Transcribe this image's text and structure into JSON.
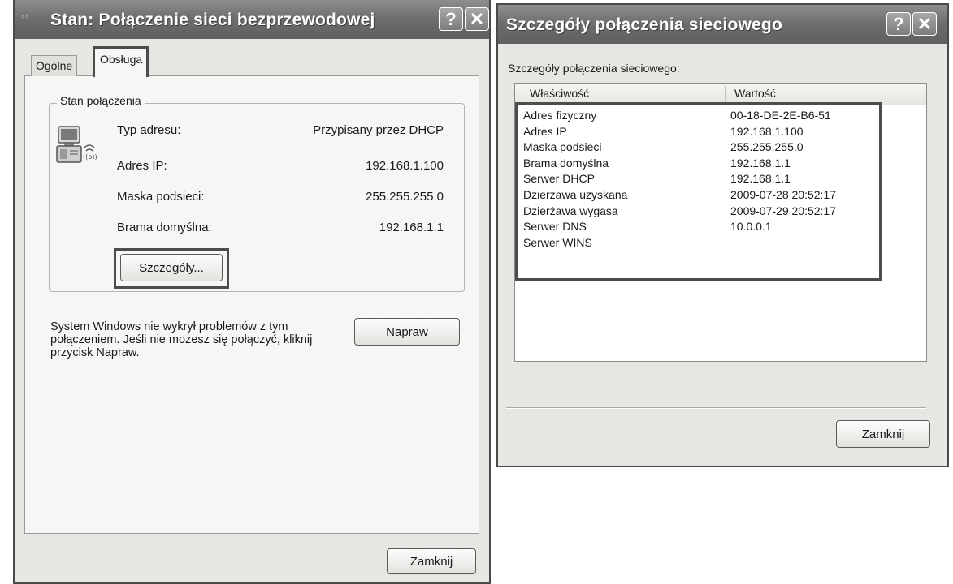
{
  "status_window": {
    "title": "Stan: Połączenie sieci bezprzewodowej",
    "help_glyph": "?",
    "close_glyph": "✕",
    "tabs": [
      {
        "label": "Ogólne",
        "active": false
      },
      {
        "label": "Obsługa",
        "active": true
      }
    ],
    "group_label": "Stan połączenia",
    "fields": [
      {
        "label": "Typ adresu:",
        "value": "Przypisany przez DHCP"
      },
      {
        "label": "Adres IP:",
        "value": "192.168.1.100"
      },
      {
        "label": "Maska podsieci:",
        "value": "255.255.255.0"
      },
      {
        "label": "Brama domyślna:",
        "value": "192.168.1.1"
      }
    ],
    "details_button": "Szczegóły...",
    "repair_message": "System Windows nie wykrył problemów z tym połączeniem. Jeśli nie możesz się połączyć, kliknij przycisk Napraw.",
    "repair_button": "Napraw",
    "close_button": "Zamknij"
  },
  "details_window": {
    "title": "Szczegóły połączenia sieciowego",
    "help_glyph": "?",
    "close_glyph": "✕",
    "caption": "Szczegóły połączenia sieciowego:",
    "columns": {
      "property": "Właściwość",
      "value": "Wartość"
    },
    "rows": [
      {
        "property": "Adres fizyczny",
        "value": "00-18-DE-2E-B6-51"
      },
      {
        "property": "Adres IP",
        "value": "192.168.1.100"
      },
      {
        "property": "Maska podsieci",
        "value": "255.255.255.0"
      },
      {
        "property": "Brama domyślna",
        "value": "192.168.1.1"
      },
      {
        "property": "Serwer DHCP",
        "value": "192.168.1.1"
      },
      {
        "property": "Dzierżawa uzyskana",
        "value": "2009-07-28 20:52:17"
      },
      {
        "property": "Dzierżawa wygasa",
        "value": "2009-07-29 20:52:17"
      },
      {
        "property": "Serwer DNS",
        "value": "10.0.0.1"
      },
      {
        "property": "Serwer WINS",
        "value": ""
      }
    ],
    "close_button": "Zamknij"
  },
  "icons": {
    "network_connection": "network-connection-icon",
    "help": "help-icon",
    "close": "close-icon"
  },
  "colors": {
    "title_bar": "#707070",
    "highlight_border": "#4c4c4c"
  }
}
